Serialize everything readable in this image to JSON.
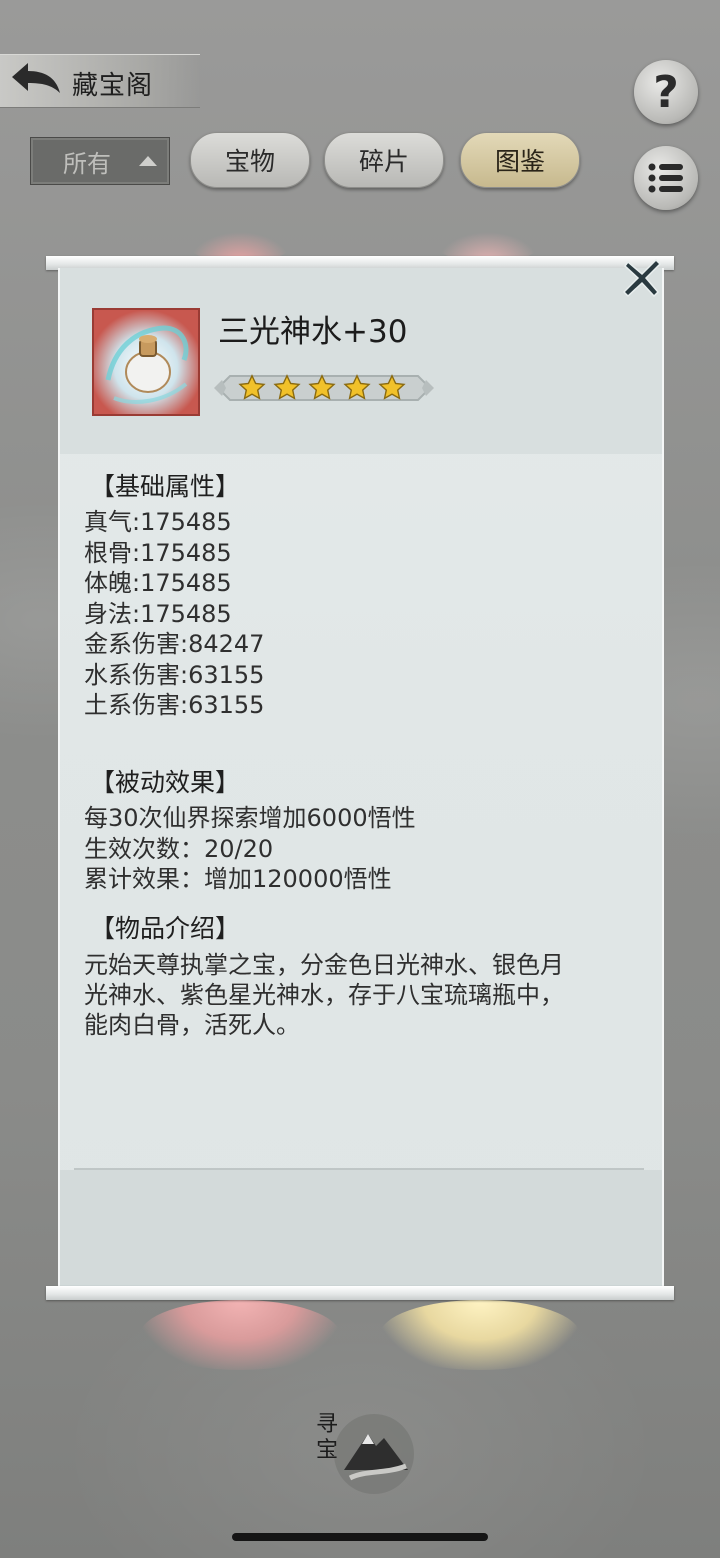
{
  "header": {
    "title": "藏宝阁"
  },
  "filters": {
    "select": {
      "label": "所有"
    },
    "tabs": [
      {
        "label": "宝物",
        "active": false
      },
      {
        "label": "碎片",
        "active": false
      },
      {
        "label": "图鉴",
        "active": true
      }
    ]
  },
  "top_right": {
    "help_label": "?"
  },
  "dialog": {
    "item": {
      "name": "三光神水+30",
      "stars": 5,
      "icon": "water-bottle-icon"
    },
    "base_attributes": {
      "title": "【基础属性】",
      "lines": [
        "真气:175485",
        "根骨:175485",
        "体魄:175485",
        "身法:175485",
        "金系伤害:84247",
        "水系伤害:63155",
        "土系伤害:63155"
      ]
    },
    "passive": {
      "title": "【被动效果】",
      "lines": [
        "每30次仙界探索增加6000悟性",
        "生效次数：20/20",
        "累计效果：增加120000悟性"
      ]
    },
    "intro": {
      "title": "【物品介绍】",
      "lines": [
        "元始天尊执掌之宝，分金色日光神水、银色月",
        "光神水、紫色星光神水，存于八宝琉璃瓶中，",
        "能肉白骨，活死人。"
      ]
    }
  },
  "bottom": {
    "seek_label": "寻宝"
  }
}
